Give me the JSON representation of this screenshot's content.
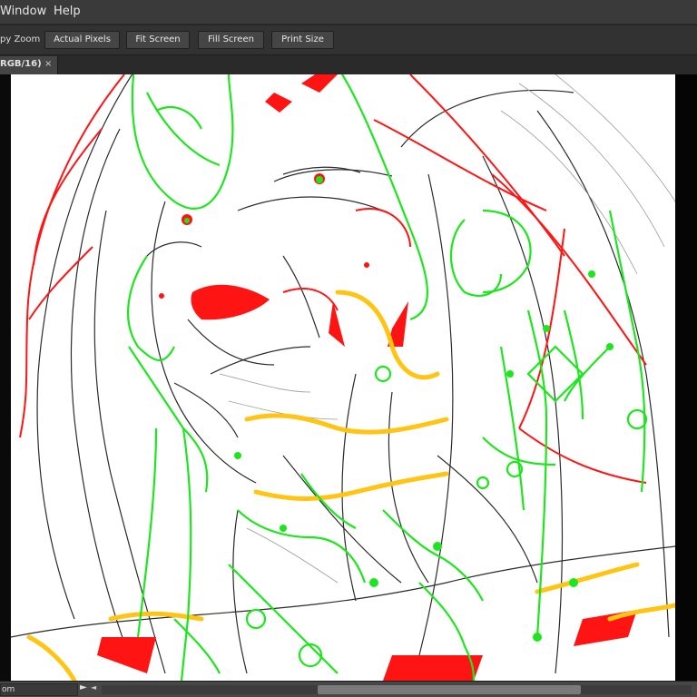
{
  "menu": {
    "items": [
      "Window",
      "Help"
    ]
  },
  "options_bar": {
    "zoom_label": "py Zoom",
    "buttons": [
      "Actual Pixels",
      "Fit Screen",
      "Fill Screen",
      "Print Size"
    ]
  },
  "document_tab": {
    "label": "RGB/16)",
    "close": "×"
  },
  "status_bar": {
    "zoom_text": "om",
    "menu_arrow": "►",
    "scroll_left": "◄",
    "scroll_position": 0.5
  },
  "colors": {
    "sketch_gray": "#2b2b2b",
    "red": "#ff1414",
    "green": "#1ee61e",
    "yellow": "#ffc414"
  }
}
